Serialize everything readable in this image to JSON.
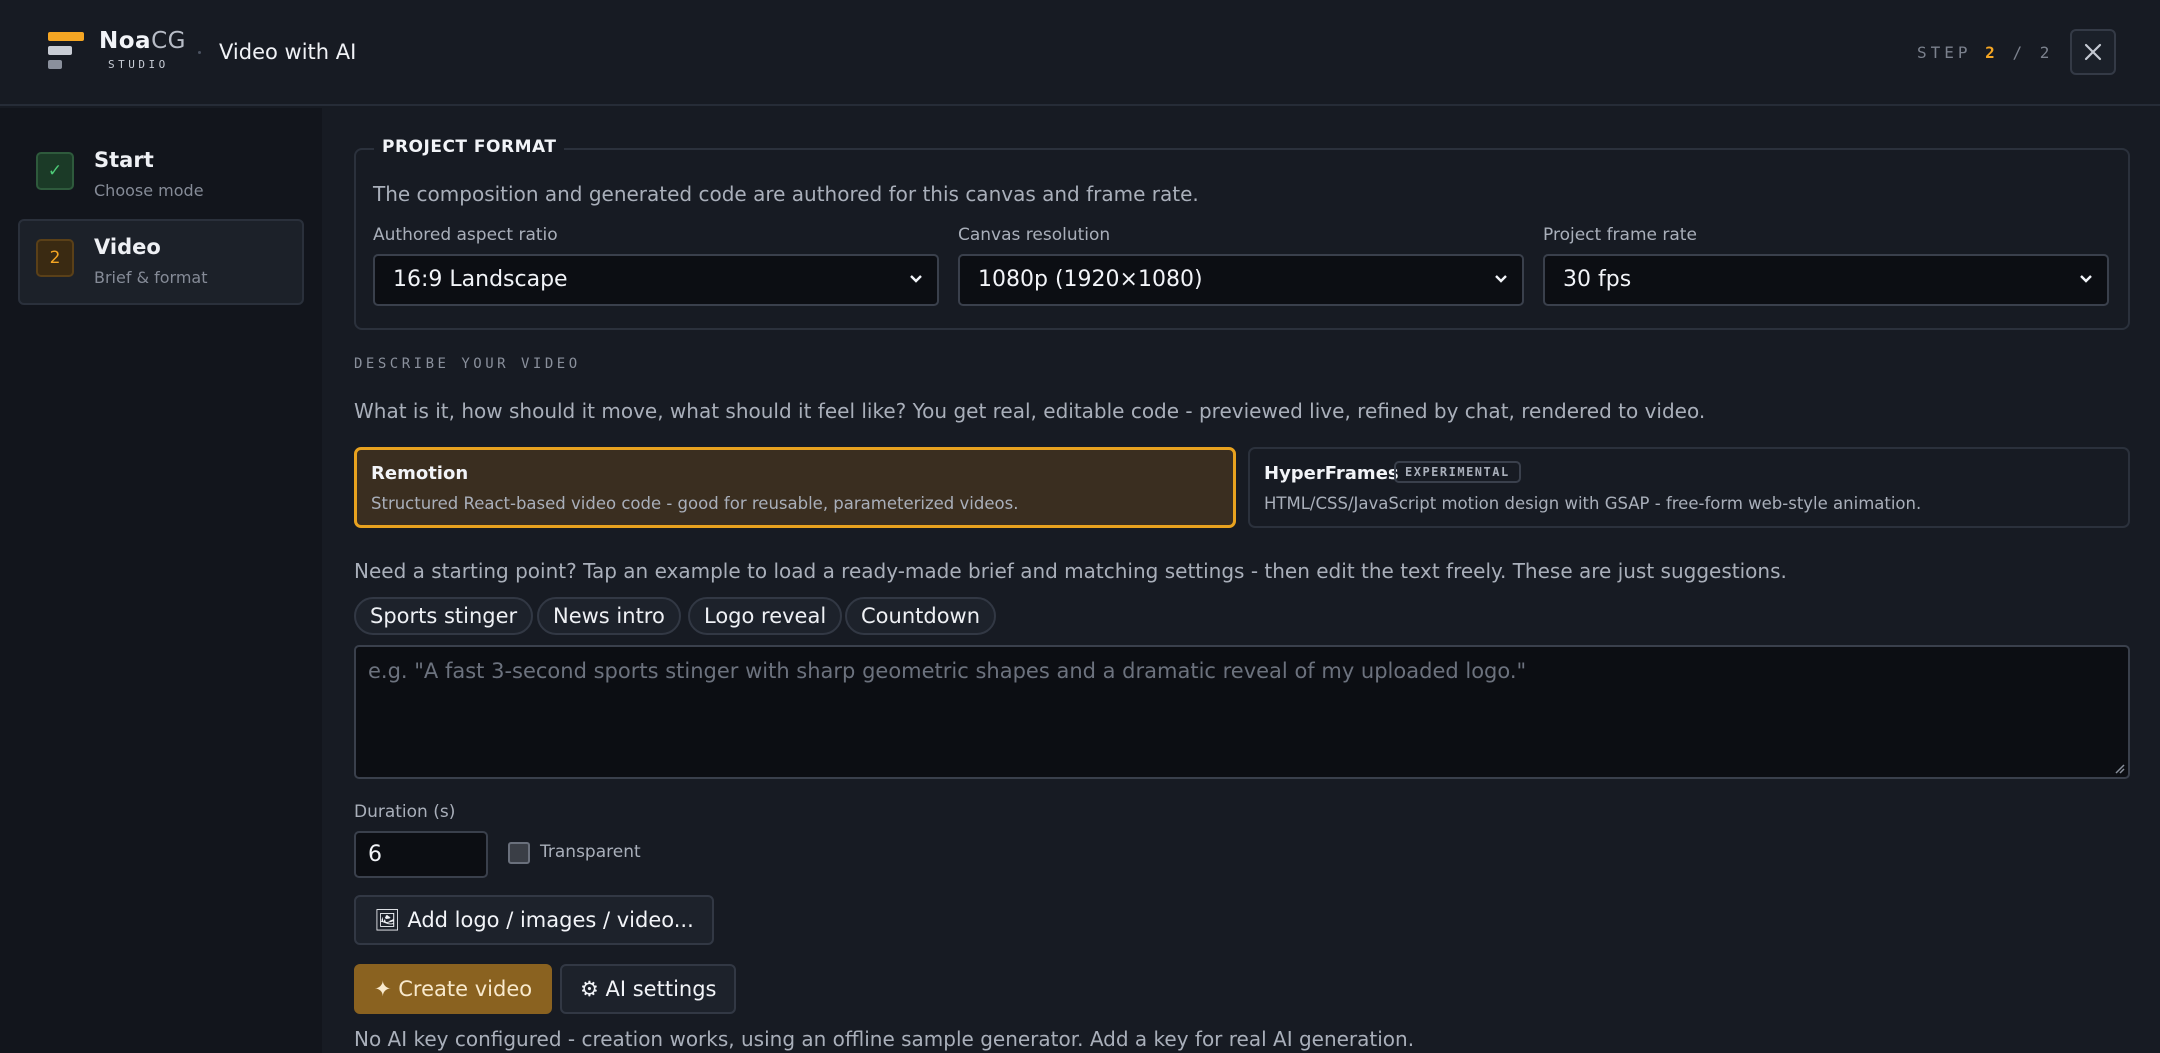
{
  "header": {
    "brand_main": "Noa",
    "brand_accent": "CG",
    "brand_sub": "STUDIO",
    "app_title": "Video with AI",
    "step_prefix": "STEP",
    "step_current": "2",
    "step_sep": "/",
    "step_total": "2",
    "close_icon": "close-icon"
  },
  "sidebar": {
    "items": [
      {
        "badge": "✓",
        "title": "Start",
        "subtitle": "Choose mode",
        "state": "done"
      },
      {
        "badge": "2",
        "title": "Video",
        "subtitle": "Brief & format",
        "state": "active"
      }
    ]
  },
  "format": {
    "legend": "PROJECT FORMAT",
    "description": "The composition and generated code are authored for this canvas and frame rate.",
    "aspect": {
      "label": "Authored aspect ratio",
      "value": "16:9 Landscape"
    },
    "resolution": {
      "label": "Canvas resolution",
      "value": "1080p (1920×1080)"
    },
    "framerate": {
      "label": "Project frame rate",
      "value": "30 fps"
    }
  },
  "describe": {
    "heading": "DESCRIBE YOUR VIDEO",
    "intro": "What is it, how should it move, what should it feel like? You get real, editable code - previewed live, refined by chat, rendered to video."
  },
  "engines": [
    {
      "title": "Remotion",
      "desc": "Structured React-based video code - good for reusable, parameterized videos.",
      "selected": true
    },
    {
      "title": "HyperFrames",
      "tag": "EXPERIMENTAL",
      "desc": "HTML/CSS/JavaScript motion design with GSAP - free-form web-style animation.",
      "selected": false
    }
  ],
  "examples": {
    "hint": "Need a starting point? Tap an example to load a ready-made brief and matching settings - then edit the text freely. These are just suggestions.",
    "chips": [
      "Sports stinger",
      "News intro",
      "Logo reveal",
      "Countdown"
    ]
  },
  "brief": {
    "value": "",
    "placeholder": "e.g. \"A fast 3-second sports stinger with sharp geometric shapes and a dramatic reveal of my uploaded logo.\""
  },
  "duration": {
    "label": "Duration (s)",
    "value": "6"
  },
  "transparent": {
    "label": "Transparent",
    "checked": false
  },
  "actions": {
    "add_media": "🖼 Add logo / images / video...",
    "create": "✦ Create video",
    "ai_settings": "⚙ AI settings"
  },
  "footer_note": "No AI key configured - creation works, using an offline sample generator. Add a key for real AI generation.",
  "colors": {
    "accent": "#f5a623",
    "background": "#171b23",
    "sidebar": "#12151c",
    "success": "#4ecb78"
  }
}
